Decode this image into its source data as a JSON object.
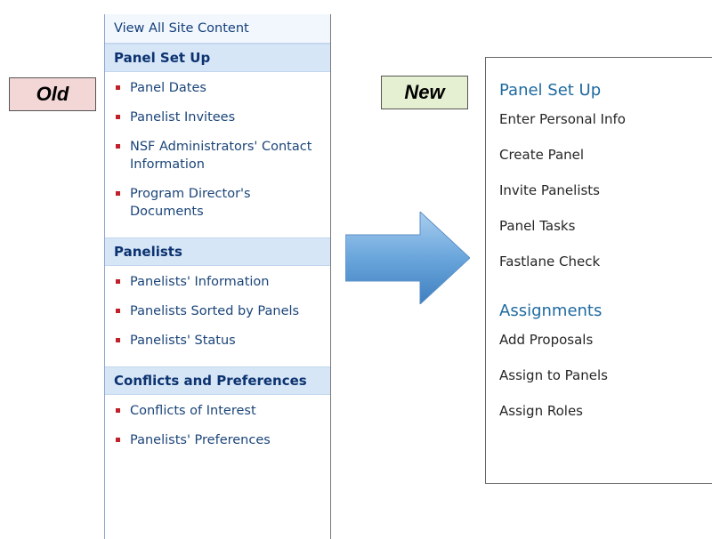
{
  "labels": {
    "old": "Old",
    "new": "New"
  },
  "old_nav": {
    "top_link": "View All Site Content",
    "sections": [
      {
        "header": "Panel Set Up",
        "items": [
          "Panel Dates",
          "Panelist Invitees",
          "NSF Administrators' Contact Information",
          "Program Director's Documents"
        ]
      },
      {
        "header": "Panelists",
        "items": [
          "Panelists' Information",
          "Panelists Sorted by Panels",
          "Panelists' Status"
        ]
      },
      {
        "header": "Conflicts and Preferences",
        "items": [
          "Conflicts of Interest",
          "Panelists' Preferences"
        ]
      }
    ]
  },
  "new_nav": {
    "sections": [
      {
        "header": "Panel Set Up",
        "items": [
          "Enter Personal Info",
          "Create Panel",
          "Invite Panelists",
          "Panel Tasks",
          "Fastlane Check"
        ]
      },
      {
        "header": "Assignments",
        "items": [
          "Add Proposals",
          "Assign to Panels",
          "Assign Roles"
        ]
      }
    ]
  },
  "colors": {
    "old_header_bg": "#d7e6f7",
    "old_link": "#1b4579",
    "bullet": "#c0202a",
    "new_header": "#1f6aa0",
    "arrow": "#5b9bd5"
  },
  "icons": {
    "arrow": "right-arrow-icon",
    "bullet": "square-bullet-icon"
  }
}
